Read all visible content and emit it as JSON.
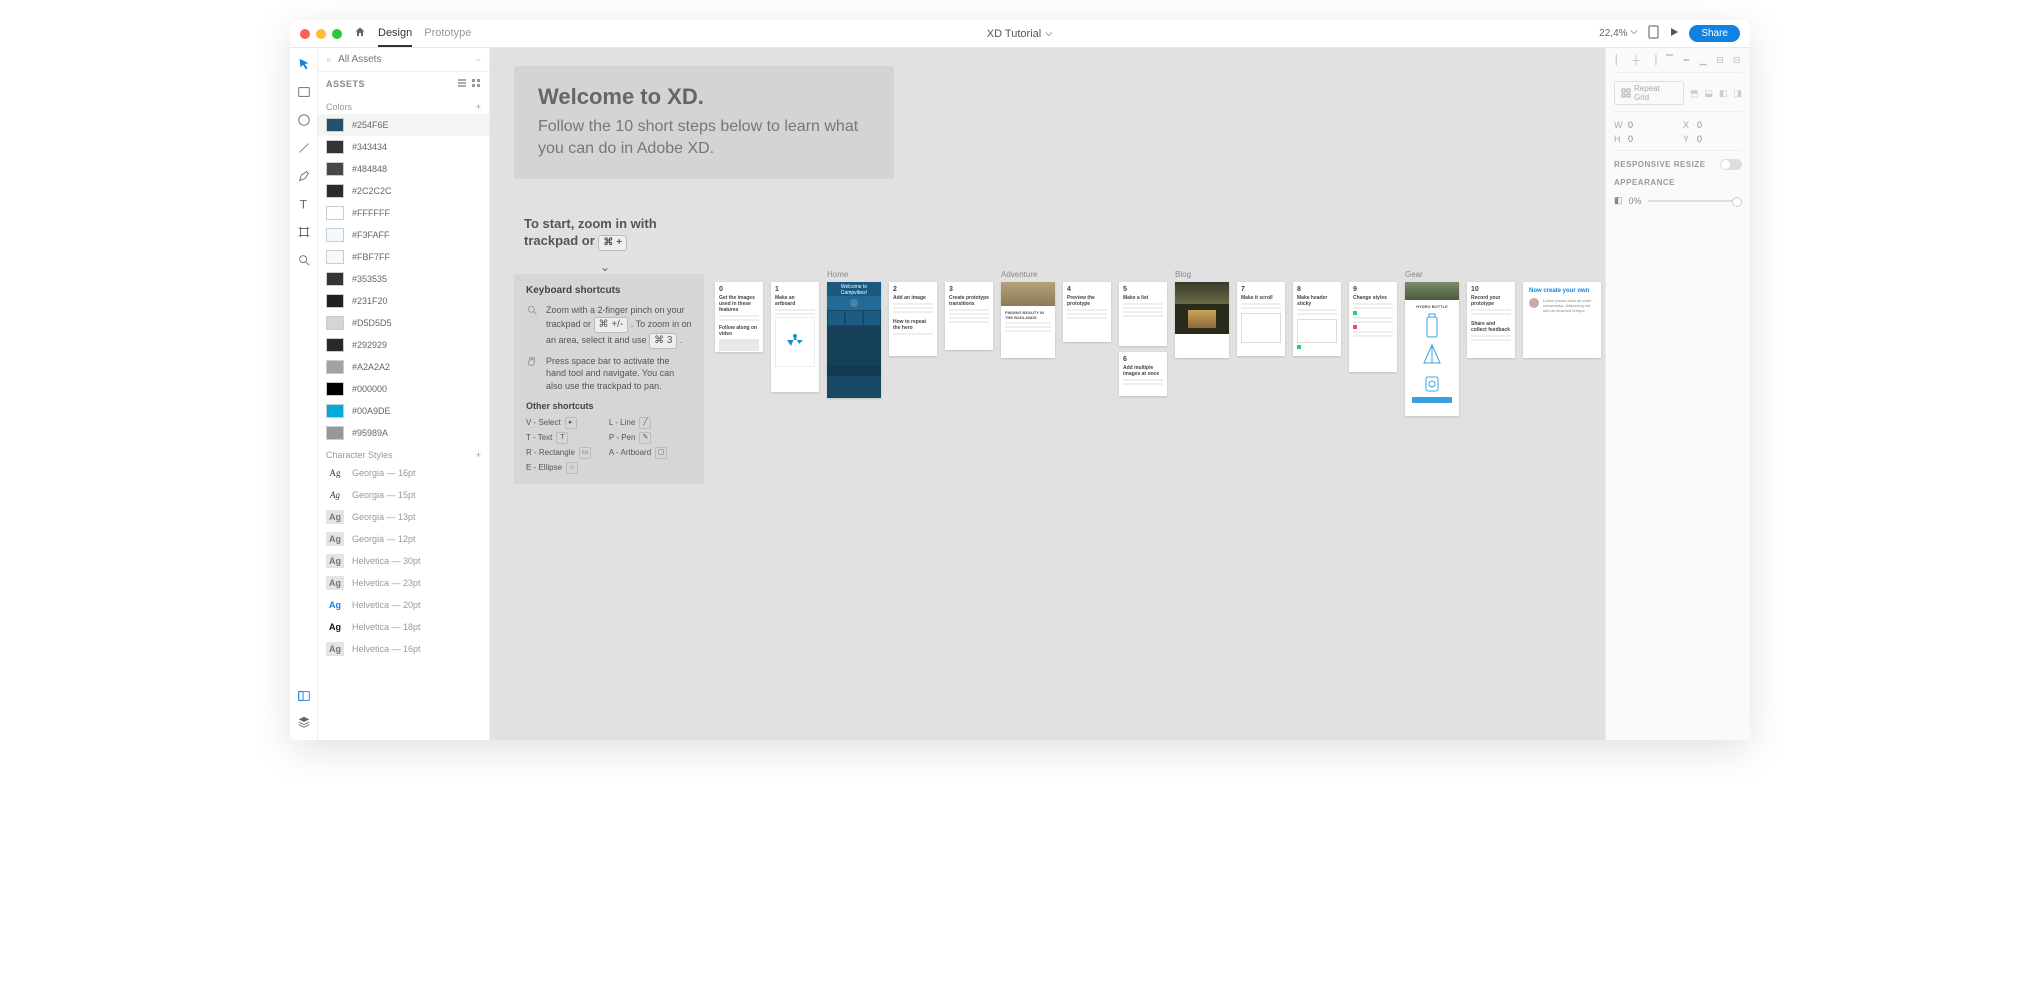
{
  "titlebar": {
    "tabs": {
      "design": "Design",
      "prototype": "Prototype"
    },
    "document": "XD Tutorial",
    "zoom": "22,4%",
    "share": "Share"
  },
  "assets": {
    "search_placeholder": "All Assets",
    "header": "ASSETS",
    "colors_label": "Colors",
    "char_label": "Character Styles",
    "colors": [
      {
        "hex": "#254F6E",
        "sel": true
      },
      {
        "hex": "#343434"
      },
      {
        "hex": "#484848"
      },
      {
        "hex": "#2C2C2C"
      },
      {
        "hex": "#FFFFFF"
      },
      {
        "hex": "#F3FAFF"
      },
      {
        "hex": "#FBF7FF"
      },
      {
        "hex": "#353535"
      },
      {
        "hex": "#231F20"
      },
      {
        "hex": "#D5D5D5"
      },
      {
        "hex": "#292929"
      },
      {
        "hex": "#A2A2A2"
      },
      {
        "hex": "#000000"
      },
      {
        "hex": "#00A9DE"
      },
      {
        "hex": "#95989A"
      }
    ],
    "chars": [
      {
        "label": "Georgia — 16pt",
        "fam": "Georgia",
        "weight": "normal",
        "color": "#333"
      },
      {
        "label": "Georgia — 15pt",
        "fam": "Georgia",
        "weight": "normal",
        "style": "italic",
        "color": "#333"
      },
      {
        "label": "Georgia — 13pt"
      },
      {
        "label": "Georgia — 12pt"
      },
      {
        "label": "Helvetica — 30pt"
      },
      {
        "label": "Helvetica — 23pt"
      },
      {
        "label": "Helvetica — 20pt",
        "color": "#1282e2"
      },
      {
        "label": "Helvetica — 18pt",
        "color": "#111",
        "weight": "bold"
      },
      {
        "label": "Helvetica — 16pt"
      }
    ]
  },
  "canvas": {
    "welcome_title": "Welcome to XD.",
    "welcome_body": "Follow the 10 short steps below to learn what you can do in Adobe XD.",
    "start_line1": "To start, zoom in with",
    "start_line2": "trackpad or ",
    "start_kbd": "⌘ +",
    "shortcuts": {
      "title": "Keyboard shortcuts",
      "zoom_tip": "Zoom with a 2-finger pinch on your trackpad or",
      "zoom_kbd1": "⌘ +/-",
      "zoom_tip2": ". To zoom in on an area, select it and use",
      "zoom_kbd2": "⌘ 3",
      "hand_tip": "Press space bar to activate the hand tool and navigate. You can also use the trackpad to pan.",
      "other": "Other shortcuts",
      "left": [
        "V - Select",
        "T - Text",
        "R - Rectangle",
        "E - Ellipse"
      ],
      "right": [
        "L - Line",
        "P - Pen",
        "A - Artboard"
      ]
    },
    "labels": {
      "home": "Home",
      "adventure": "Adventure",
      "blog": "Blog",
      "gear": "Gear"
    },
    "steps": {
      "s0": "Get the images used in these features",
      "s0b": "Follow along on video",
      "s1": "Make an artboard",
      "s2": "Add an image",
      "s2b": "How to repeat the hero",
      "s3": "Create prototype transitions",
      "s4": "Preview the prototype",
      "s5": "Make a list",
      "s6": "Add multiple images at once",
      "s7": "Make it scroll",
      "s8": "Make header sticky",
      "s9": "Change styles",
      "s10": "Record your prototype",
      "s10b": "Share and collect feedback",
      "create": "Now create your own"
    },
    "home_hdr": "Welcome to Campvibes!"
  },
  "right": {
    "repeat": "Repeat Grid",
    "w": "W",
    "wval": "0",
    "x": "X",
    "xval": "0",
    "h": "H",
    "hval": "0",
    "y": "Y",
    "yval": "0",
    "responsive": "RESPONSIVE RESIZE",
    "appearance": "APPEARANCE",
    "opacity": "0%"
  }
}
